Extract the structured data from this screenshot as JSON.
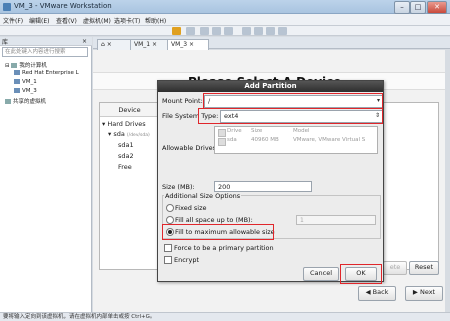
{
  "window": {
    "title": "VM_3 - VMware Workstation",
    "minimize": "–",
    "maximize": "□",
    "close": "✕"
  },
  "menu": [
    "文件(F)",
    "编辑(E)",
    "查看(V)",
    "虚拟机(M)",
    "选项卡(T)",
    "帮助(H)"
  ],
  "library": {
    "header": "库",
    "search_placeholder": "在此处键入内容进行搜索",
    "root": "我的计算机",
    "vms": [
      "Red Hat Enterprise L",
      "VM_1",
      "VM_3"
    ],
    "shared": "共享的虚拟机"
  },
  "tabs": [
    "VM_1",
    "VM_3"
  ],
  "installer": {
    "heading": "Please Select A Device",
    "device_header": "Device",
    "tree": [
      "Hard Drives",
      "sda",
      "(/dev/sda)",
      "sda1",
      "sda2",
      "Free"
    ],
    "reset": "Reset",
    "delete_stub": "ete",
    "back": "Back",
    "next": "Next"
  },
  "dialog": {
    "title": "Add Partition",
    "mount_point_label": "Mount Point:",
    "mount_point_value": "/",
    "fs_type_label": "File System Type:",
    "fs_type_value": "ext4",
    "allowable_label": "Allowable Drives:",
    "drive_columns": [
      "Drive",
      "Size",
      "Model"
    ],
    "drive_row": [
      "sda",
      "40960 MB",
      "VMware, VMware Virtual S"
    ],
    "size_label": "Size (MB):",
    "size_value": "200",
    "options_label": "Additional Size Options",
    "fixed": "Fixed size",
    "fill_up_to": "Fill all space up to (MB):",
    "fill_up_to_value": "1",
    "fill_max": "Fill to maximum allowable size",
    "force_primary": "Force to be a primary partition",
    "encrypt": "Encrypt",
    "cancel": "Cancel",
    "ok": "OK"
  },
  "status": {
    "text": "要将输入定向到该虚拟机，请在虚拟机内部单击或按 Ctrl+G。"
  },
  "colors": {
    "highlight": "#e0262b",
    "titlebar": "#a9c4e0"
  }
}
